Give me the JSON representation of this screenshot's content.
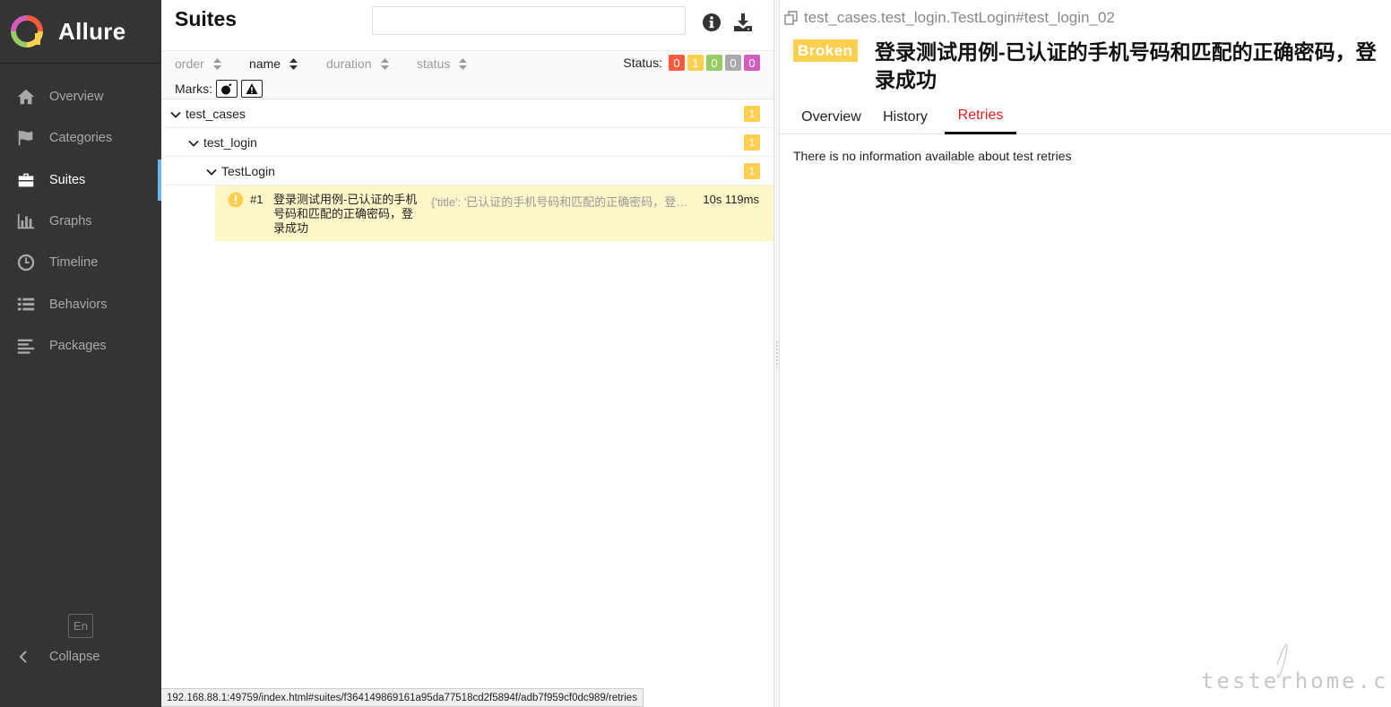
{
  "app": {
    "brand": "Allure",
    "colors": {
      "sidebar_bg": "#343434",
      "accent": "#6eb5ee",
      "broken": "#ffd050",
      "failed": "#fd5a3e",
      "passed": "#97cc64",
      "skipped": "#aaaaaa",
      "unknown": "#d35ebe",
      "active_tab": "#e31d1d"
    }
  },
  "sidebar": {
    "items": [
      {
        "label": "Overview",
        "icon": "home-icon"
      },
      {
        "label": "Categories",
        "icon": "flag-icon"
      },
      {
        "label": "Suites",
        "icon": "briefcase-icon",
        "active": true
      },
      {
        "label": "Graphs",
        "icon": "bar-chart-icon"
      },
      {
        "label": "Timeline",
        "icon": "clock-icon"
      },
      {
        "label": "Behaviors",
        "icon": "list-icon"
      },
      {
        "label": "Packages",
        "icon": "align-left-icon"
      }
    ],
    "language": "En",
    "collapse_label": "Collapse"
  },
  "suites": {
    "title": "Suites",
    "search": {
      "value": "",
      "placeholder": ""
    },
    "sorters": [
      {
        "label": "order",
        "active": false
      },
      {
        "label": "name",
        "active": true
      },
      {
        "label": "duration",
        "active": false
      },
      {
        "label": "status",
        "active": false
      }
    ],
    "status_label": "Status:",
    "status_counts": [
      {
        "status": "failed",
        "value": "0",
        "color": "#fd5a3e"
      },
      {
        "status": "broken",
        "value": "1",
        "color": "#ffd050"
      },
      {
        "status": "passed",
        "value": "0",
        "color": "#97cc64"
      },
      {
        "status": "skipped",
        "value": "0",
        "color": "#aaaaaa"
      },
      {
        "status": "unknown",
        "value": "0",
        "color": "#d35ebe"
      }
    ],
    "marks_label": "Marks:",
    "tree": [
      {
        "label": "test_cases",
        "count": "1"
      },
      {
        "label": "test_login",
        "count": "1"
      },
      {
        "label": "TestLogin",
        "count": "1"
      }
    ],
    "case": {
      "number": "#1",
      "name": "登录测试用例-已认证的手机号码和匹配的正确密码，登录成功",
      "params": "{'title': '已认证的手机号码和匹配的正确密码，登录成功'}",
      "duration": "10s 119ms",
      "status": "broken"
    }
  },
  "status_url": "192.168.88.1:49759/index.html#suites/f364149869161a95da77518cd2f5894f/adb7f959cf0dc989/retries",
  "detail": {
    "full_name": "test_cases.test_login.TestLogin#test_login_02",
    "status_badge": "Broken",
    "title": "登录测试用例-已认证的手机号码和匹配的正确密码，登录成功",
    "tabs": [
      {
        "label": "Overview",
        "active": false
      },
      {
        "label": "History",
        "active": false
      },
      {
        "label": "Retries",
        "active": true
      }
    ],
    "retries_message": "There is no information available about test retries"
  }
}
